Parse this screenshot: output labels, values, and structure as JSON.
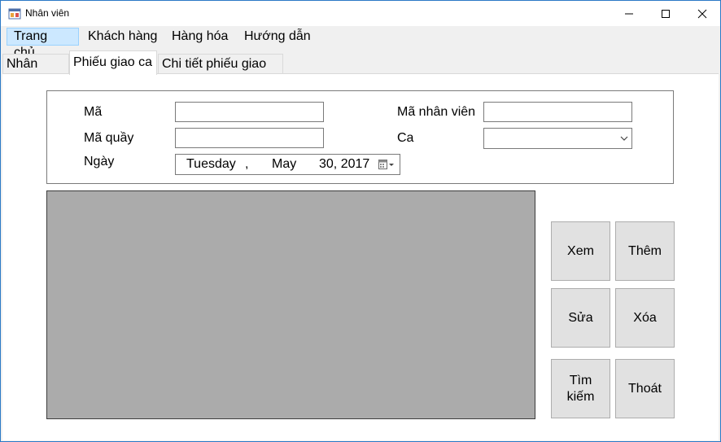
{
  "window": {
    "title": "Nhân viên"
  },
  "menu": {
    "items": [
      "Trang chủ",
      "Khách hàng",
      "Hàng hóa",
      "Hướng dẫn"
    ]
  },
  "tabs": [
    "Nhân viên",
    "Phiếu giao ca",
    "Chi tiết phiếu giao ca"
  ],
  "form": {
    "ma_label": "Mã",
    "ma_quay_label": "Mã quầy",
    "ngay_label": "Ngày",
    "ma_nhan_vien_label": "Mã nhân viên",
    "ca_label": "Ca",
    "ma_value": "",
    "ma_quay_value": "",
    "ma_nhan_vien_value": "",
    "ca_value": "",
    "date": {
      "weekday": "Tuesday",
      "sep": ",",
      "month": "May",
      "day_year": "30, 2017"
    }
  },
  "buttons": {
    "xem": "Xem",
    "them": "Thêm",
    "sua": "Sửa",
    "xoa": "Xóa",
    "tim_kiem_line1": "Tìm",
    "tim_kiem_line2": "kiếm",
    "thoat": "Thoát"
  },
  "icons": {
    "app": "app-icon",
    "minimize": "minimize-icon",
    "maximize": "maximize-icon",
    "close": "close-icon",
    "dropdown": "chevron-down-icon",
    "calendar": "calendar-icon"
  }
}
